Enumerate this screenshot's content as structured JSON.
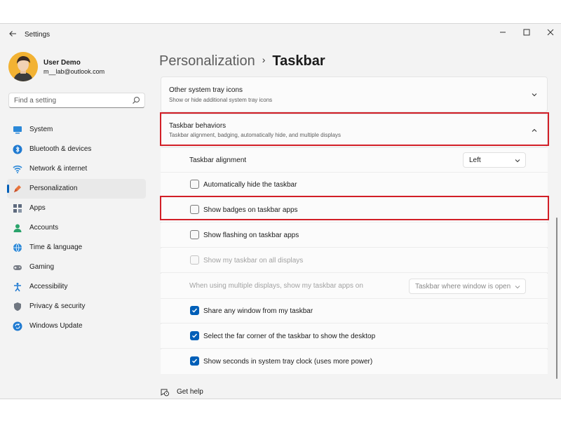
{
  "window": {
    "title": "Settings",
    "back_icon": "←",
    "controls": {
      "minimize": "—",
      "maximize": "☐",
      "close": "✕"
    }
  },
  "user": {
    "name": "User Demo",
    "email": "m__lab@outlook.com"
  },
  "search": {
    "placeholder": "Find a setting"
  },
  "sidebar": {
    "items": [
      {
        "label": "System",
        "icon": "system-icon"
      },
      {
        "label": "Bluetooth & devices",
        "icon": "bluetooth-icon"
      },
      {
        "label": "Network & internet",
        "icon": "network-icon"
      },
      {
        "label": "Personalization",
        "icon": "personalization-icon",
        "active": true
      },
      {
        "label": "Apps",
        "icon": "apps-icon"
      },
      {
        "label": "Accounts",
        "icon": "accounts-icon"
      },
      {
        "label": "Time & language",
        "icon": "time-language-icon"
      },
      {
        "label": "Gaming",
        "icon": "gaming-icon"
      },
      {
        "label": "Accessibility",
        "icon": "accessibility-icon"
      },
      {
        "label": "Privacy & security",
        "icon": "privacy-icon"
      },
      {
        "label": "Windows Update",
        "icon": "windows-update-icon"
      }
    ]
  },
  "breadcrumb": {
    "parent": "Personalization",
    "separator": "›",
    "current": "Taskbar"
  },
  "sections": {
    "tray": {
      "title": "Other system tray icons",
      "description": "Show or hide additional system tray icons",
      "expanded": false
    },
    "behaviors": {
      "title": "Taskbar behaviors",
      "description": "Taskbar alignment, badging, automatically hide, and multiple displays",
      "expanded": true,
      "alignment": {
        "label": "Taskbar alignment",
        "value": "Left"
      },
      "options": [
        {
          "label": "Automatically hide the taskbar",
          "checked": false,
          "disabled": false
        },
        {
          "label": "Show badges on taskbar apps",
          "checked": false,
          "disabled": false
        },
        {
          "label": "Show flashing on taskbar apps",
          "checked": false,
          "disabled": false
        },
        {
          "label": "Show my taskbar on all displays",
          "checked": false,
          "disabled": true
        }
      ],
      "multi_display": {
        "label": "When using multiple displays, show my taskbar apps on",
        "value": "Taskbar where window is open",
        "disabled": true
      },
      "options2": [
        {
          "label": "Share any window from my taskbar",
          "checked": true
        },
        {
          "label": "Select the far corner of the taskbar to show the desktop",
          "checked": true
        },
        {
          "label": "Show seconds in system tray clock (uses more power)",
          "checked": true
        }
      ]
    }
  },
  "help": {
    "label": "Get help"
  },
  "colors": {
    "accent": "#005fb8",
    "highlight": "#d21f27",
    "background": "#f3f3f3",
    "card": "#fbfbfb"
  }
}
